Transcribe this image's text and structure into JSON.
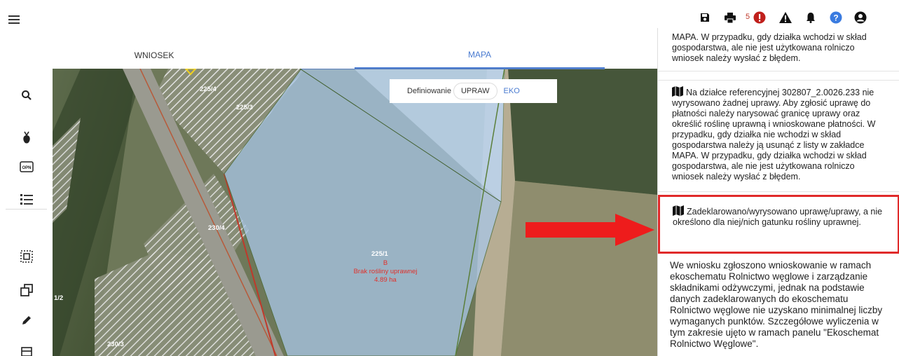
{
  "tabs": {
    "wniosek": "WNIOSEK",
    "mapa": "MAPA"
  },
  "toolbar": {
    "error_count": "5"
  },
  "defining": {
    "label": "Definiowanie",
    "upraw": "UPRAW",
    "eko": "EKO"
  },
  "map": {
    "parcels": [
      "225/4",
      "225/3",
      "230/4",
      "225/1",
      "1/2",
      "230/3"
    ],
    "crop_label": {
      "code": "B",
      "note": "Brak rośliny uprawnej",
      "area": "4.89 ha"
    }
  },
  "panel": {
    "msg1": "MAPA. W przypadku, gdy działka wchodzi w skład gospodarstwa, ale nie jest użytkowana rolniczo wniosek należy wysłać z błędem.",
    "msg2": "Na działce referencyjnej 302807_2.0026.233 nie wyrysowano żadnej uprawy. Aby zgłosić uprawę do płatności należy narysować granicę uprawy oraz określić roślinę uprawną i wnioskowane płatności. W przypadku, gdy działka nie wchodzi w skład gospodarstwa należy ją usunąć z listy w zakładce MAPA. W przypadku, gdy działka wchodzi w skład gospodarstwa, ale nie jest użytkowana rolniczo wniosek należy wysłać z błędem.",
    "msg3": "Zadeklarowano/wyrysowano uprawę/uprawy, a nie określono dla niej/nich gatunku rośliny uprawnej.",
    "msg4": "We wniosku zgłoszono wnioskowanie w ramach ekoschematu Rolnictwo węglowe i zarządzanie składnikami odżywczymi, jednak na podstawie danych zadeklarowanych do ekoschematu Rolnictwo węglowe nie uzyskano minimalnej liczby wymaganych punktów. Szczegółowe wyliczenia w tym zakresie ujęto w ramach panelu \"Ekoschemat Rolnictwo Węglowe\"."
  },
  "colors": {
    "accent": "#4a7bd0",
    "error": "#e02a2a",
    "arrow": "#ee1c1c"
  }
}
